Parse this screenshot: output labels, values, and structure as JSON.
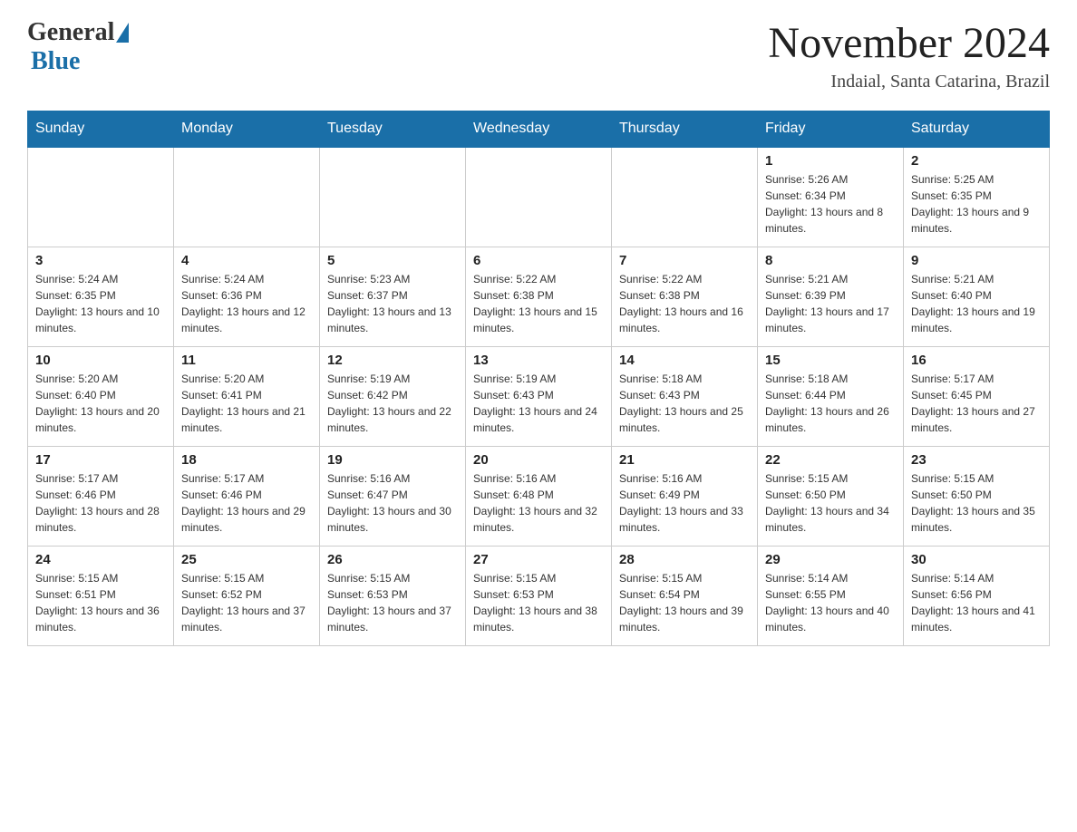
{
  "logo": {
    "general": "General",
    "blue": "Blue"
  },
  "title": "November 2024",
  "location": "Indaial, Santa Catarina, Brazil",
  "weekdays": [
    "Sunday",
    "Monday",
    "Tuesday",
    "Wednesday",
    "Thursday",
    "Friday",
    "Saturday"
  ],
  "weeks": [
    [
      {
        "day": "",
        "info": ""
      },
      {
        "day": "",
        "info": ""
      },
      {
        "day": "",
        "info": ""
      },
      {
        "day": "",
        "info": ""
      },
      {
        "day": "",
        "info": ""
      },
      {
        "day": "1",
        "info": "Sunrise: 5:26 AM\nSunset: 6:34 PM\nDaylight: 13 hours and 8 minutes."
      },
      {
        "day": "2",
        "info": "Sunrise: 5:25 AM\nSunset: 6:35 PM\nDaylight: 13 hours and 9 minutes."
      }
    ],
    [
      {
        "day": "3",
        "info": "Sunrise: 5:24 AM\nSunset: 6:35 PM\nDaylight: 13 hours and 10 minutes."
      },
      {
        "day": "4",
        "info": "Sunrise: 5:24 AM\nSunset: 6:36 PM\nDaylight: 13 hours and 12 minutes."
      },
      {
        "day": "5",
        "info": "Sunrise: 5:23 AM\nSunset: 6:37 PM\nDaylight: 13 hours and 13 minutes."
      },
      {
        "day": "6",
        "info": "Sunrise: 5:22 AM\nSunset: 6:38 PM\nDaylight: 13 hours and 15 minutes."
      },
      {
        "day": "7",
        "info": "Sunrise: 5:22 AM\nSunset: 6:38 PM\nDaylight: 13 hours and 16 minutes."
      },
      {
        "day": "8",
        "info": "Sunrise: 5:21 AM\nSunset: 6:39 PM\nDaylight: 13 hours and 17 minutes."
      },
      {
        "day": "9",
        "info": "Sunrise: 5:21 AM\nSunset: 6:40 PM\nDaylight: 13 hours and 19 minutes."
      }
    ],
    [
      {
        "day": "10",
        "info": "Sunrise: 5:20 AM\nSunset: 6:40 PM\nDaylight: 13 hours and 20 minutes."
      },
      {
        "day": "11",
        "info": "Sunrise: 5:20 AM\nSunset: 6:41 PM\nDaylight: 13 hours and 21 minutes."
      },
      {
        "day": "12",
        "info": "Sunrise: 5:19 AM\nSunset: 6:42 PM\nDaylight: 13 hours and 22 minutes."
      },
      {
        "day": "13",
        "info": "Sunrise: 5:19 AM\nSunset: 6:43 PM\nDaylight: 13 hours and 24 minutes."
      },
      {
        "day": "14",
        "info": "Sunrise: 5:18 AM\nSunset: 6:43 PM\nDaylight: 13 hours and 25 minutes."
      },
      {
        "day": "15",
        "info": "Sunrise: 5:18 AM\nSunset: 6:44 PM\nDaylight: 13 hours and 26 minutes."
      },
      {
        "day": "16",
        "info": "Sunrise: 5:17 AM\nSunset: 6:45 PM\nDaylight: 13 hours and 27 minutes."
      }
    ],
    [
      {
        "day": "17",
        "info": "Sunrise: 5:17 AM\nSunset: 6:46 PM\nDaylight: 13 hours and 28 minutes."
      },
      {
        "day": "18",
        "info": "Sunrise: 5:17 AM\nSunset: 6:46 PM\nDaylight: 13 hours and 29 minutes."
      },
      {
        "day": "19",
        "info": "Sunrise: 5:16 AM\nSunset: 6:47 PM\nDaylight: 13 hours and 30 minutes."
      },
      {
        "day": "20",
        "info": "Sunrise: 5:16 AM\nSunset: 6:48 PM\nDaylight: 13 hours and 32 minutes."
      },
      {
        "day": "21",
        "info": "Sunrise: 5:16 AM\nSunset: 6:49 PM\nDaylight: 13 hours and 33 minutes."
      },
      {
        "day": "22",
        "info": "Sunrise: 5:15 AM\nSunset: 6:50 PM\nDaylight: 13 hours and 34 minutes."
      },
      {
        "day": "23",
        "info": "Sunrise: 5:15 AM\nSunset: 6:50 PM\nDaylight: 13 hours and 35 minutes."
      }
    ],
    [
      {
        "day": "24",
        "info": "Sunrise: 5:15 AM\nSunset: 6:51 PM\nDaylight: 13 hours and 36 minutes."
      },
      {
        "day": "25",
        "info": "Sunrise: 5:15 AM\nSunset: 6:52 PM\nDaylight: 13 hours and 37 minutes."
      },
      {
        "day": "26",
        "info": "Sunrise: 5:15 AM\nSunset: 6:53 PM\nDaylight: 13 hours and 37 minutes."
      },
      {
        "day": "27",
        "info": "Sunrise: 5:15 AM\nSunset: 6:53 PM\nDaylight: 13 hours and 38 minutes."
      },
      {
        "day": "28",
        "info": "Sunrise: 5:15 AM\nSunset: 6:54 PM\nDaylight: 13 hours and 39 minutes."
      },
      {
        "day": "29",
        "info": "Sunrise: 5:14 AM\nSunset: 6:55 PM\nDaylight: 13 hours and 40 minutes."
      },
      {
        "day": "30",
        "info": "Sunrise: 5:14 AM\nSunset: 6:56 PM\nDaylight: 13 hours and 41 minutes."
      }
    ]
  ]
}
